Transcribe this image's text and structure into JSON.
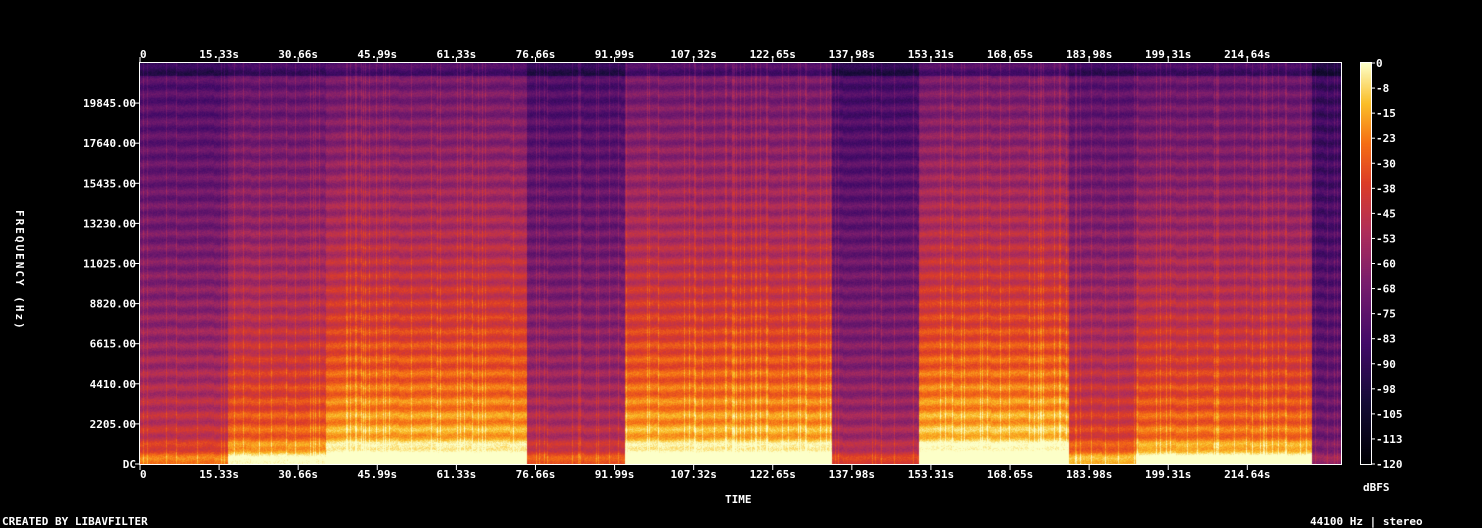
{
  "chart_data": {
    "type": "heatmap",
    "xlabel": "TIME",
    "ylabel": "FREQUENCY (Hz)",
    "x_ticks": [
      "0",
      "15.33s",
      "30.66s",
      "45.99s",
      "61.33s",
      "76.66s",
      "91.99s",
      "107.32s",
      "122.65s",
      "137.98s",
      "153.31s",
      "168.65s",
      "183.98s",
      "199.31s",
      "214.64s"
    ],
    "x_tick_values": [
      0,
      15.33,
      30.66,
      45.99,
      61.33,
      76.66,
      91.99,
      107.32,
      122.65,
      137.98,
      153.31,
      168.65,
      183.98,
      199.31,
      214.64
    ],
    "xlim": [
      0,
      232.8
    ],
    "y_ticks": [
      "DC",
      "2205.00",
      "4410.00",
      "6615.00",
      "8820.00",
      "11025.00",
      "13230.00",
      "15435.00",
      "17640.00",
      "19845.00"
    ],
    "y_tick_values": [
      0,
      2205,
      4410,
      6615,
      8820,
      11025,
      13230,
      15435,
      17640,
      19845
    ],
    "ylim": [
      0,
      22050
    ],
    "colorbar": {
      "label": "dBFS",
      "ticks": [
        "0",
        "-8",
        "-15",
        "-23",
        "-30",
        "-38",
        "-45",
        "-53",
        "-60",
        "-68",
        "-75",
        "-83",
        "-90",
        "-98",
        "-105",
        "-113",
        "-120"
      ],
      "range": [
        -120,
        0
      ]
    },
    "segments": [
      {
        "start": 0,
        "end": 17,
        "level": 0.55
      },
      {
        "start": 17,
        "end": 36,
        "level": 0.72
      },
      {
        "start": 36,
        "end": 75,
        "level": 0.85
      },
      {
        "start": 75,
        "end": 94,
        "level": 0.5
      },
      {
        "start": 94,
        "end": 134,
        "level": 0.85
      },
      {
        "start": 134,
        "end": 151,
        "level": 0.45
      },
      {
        "start": 151,
        "end": 180,
        "level": 0.88
      },
      {
        "start": 180,
        "end": 193,
        "level": 0.62
      },
      {
        "start": 193,
        "end": 227,
        "level": 0.75
      },
      {
        "start": 227,
        "end": 232.8,
        "level": 0.3
      }
    ]
  },
  "footer": {
    "credit": "CREATED BY LIBAVFILTER",
    "info": "44100 Hz | stereo"
  }
}
